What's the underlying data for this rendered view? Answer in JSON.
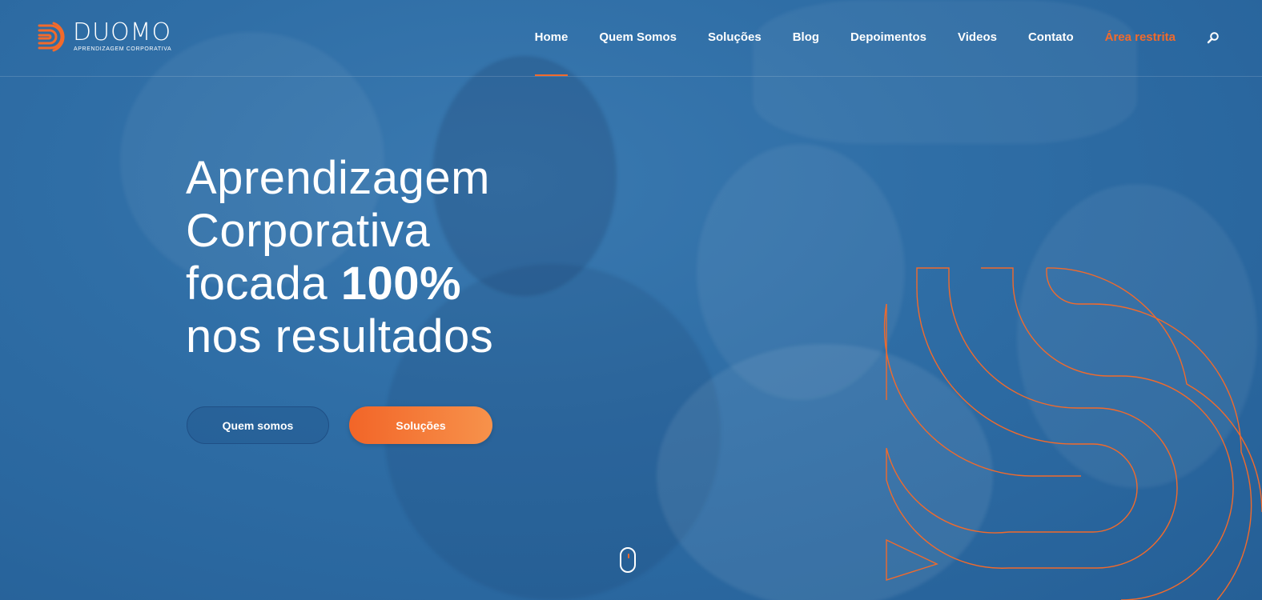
{
  "brand": {
    "name": "DUOMO",
    "tagline": "APRENDIZAGEM CORPORATIVA",
    "accent_color": "#f26a2b",
    "background_color": "#2f6ea6"
  },
  "nav": {
    "items": [
      {
        "label": "Home",
        "active": true
      },
      {
        "label": "Quem Somos"
      },
      {
        "label": "Soluções"
      },
      {
        "label": "Blog"
      },
      {
        "label": "Depoimentos"
      },
      {
        "label": "Videos"
      },
      {
        "label": "Contato"
      },
      {
        "label": "Área restrita",
        "highlight": true
      }
    ],
    "search_icon": "search-icon"
  },
  "hero": {
    "line1": "Aprendizagem",
    "line2": "Corporativa",
    "line3_prefix": "focada ",
    "line3_bold": "100%",
    "line4": "nos resultados",
    "buttons": {
      "primary_outline": "Quem somos",
      "primary_solid": "Soluções"
    }
  },
  "scroll_indicator": "mouse-scroll-icon"
}
